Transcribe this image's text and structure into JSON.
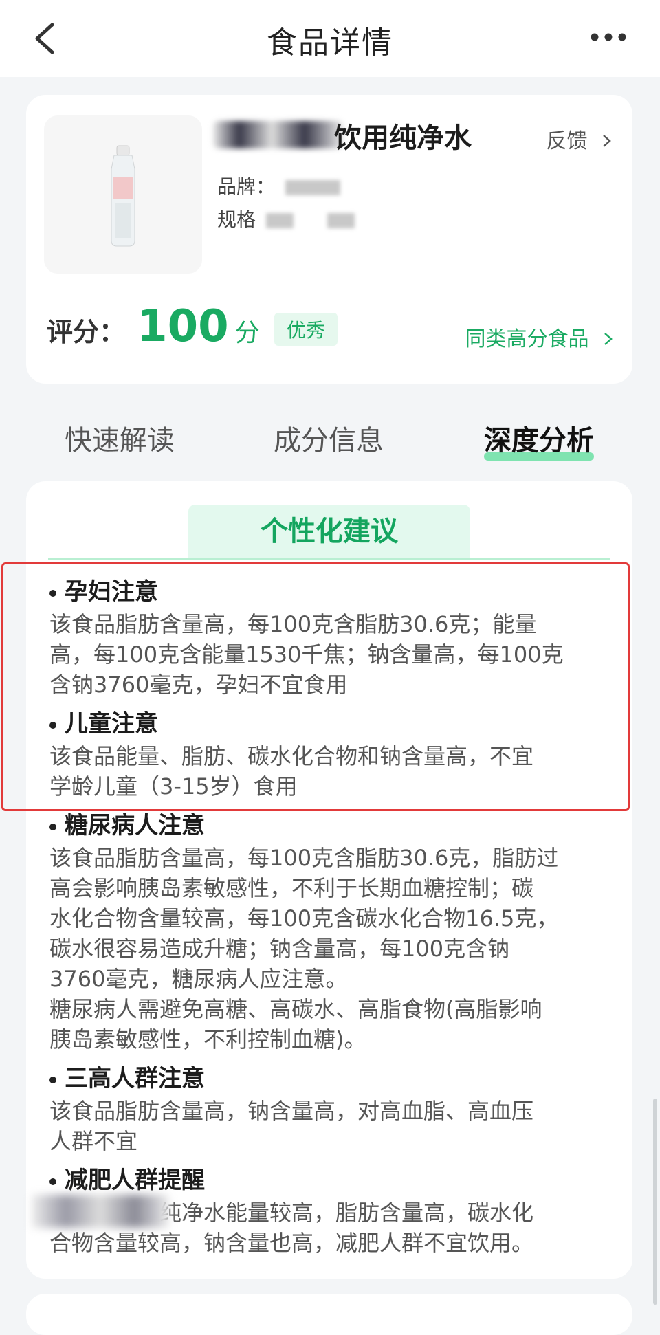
{
  "header": {
    "title": "食品详情"
  },
  "product": {
    "name": "饮用纯净水",
    "feedback": "反馈",
    "brand_label": "品牌：",
    "spec_label": "规格",
    "score_label": "评分：",
    "score_value": "100",
    "score_unit": "分",
    "score_badge": "优秀",
    "similar_link": "同类高分食品"
  },
  "tabs": [
    {
      "label": "快速解读",
      "active": false
    },
    {
      "label": "成分信息",
      "active": false
    },
    {
      "label": "深度分析",
      "active": true
    }
  ],
  "section": {
    "title": "个性化建议"
  },
  "advice": [
    {
      "title": "孕妇注意",
      "body": "该食品脂肪含量高，每100克含脂肪30.6克；能量\n高，每100克含能量1530千焦；钠含量高，每100克\n含钠3760毫克，孕妇不宜食用"
    },
    {
      "title": "儿童注意",
      "body": "该食品能量、脂肪、碳水化合物和钠含量高，不宜\n学龄儿童（3-15岁）食用"
    },
    {
      "title": "糖尿病人注意",
      "body": "该食品脂肪含量高，每100克含脂肪30.6克，脂肪过\n高会影响胰岛素敏感性，不利于长期血糖控制；碳\n水化合物含量较高，每100克含碳水化合物16.5克，\n碳水很容易造成升糖；钠含量高，每100克含钠\n3760毫克，糖尿病人应注意。\n糖尿病人需避免高糖、高碳水、高脂食物(高脂影响\n胰岛素敏感性，不利控制血糖)。"
    },
    {
      "title": "三高人群注意",
      "body": "该食品脂肪含量高，钠含量高，对高血脂、高血压\n人群不宜"
    },
    {
      "title": "减肥人群提醒",
      "body": "　　　　　纯净水能量较高，脂肪含量高，碳水化\n合物含量较高，钠含量也高，减肥人群不宜饮用。"
    }
  ],
  "colors": {
    "accent": "#1aaa62",
    "highlight": "#e23a3a"
  },
  "icons": {
    "back": "chevron-left-icon",
    "more": "more-dots-icon",
    "chevron": "chevron-right-icon"
  }
}
